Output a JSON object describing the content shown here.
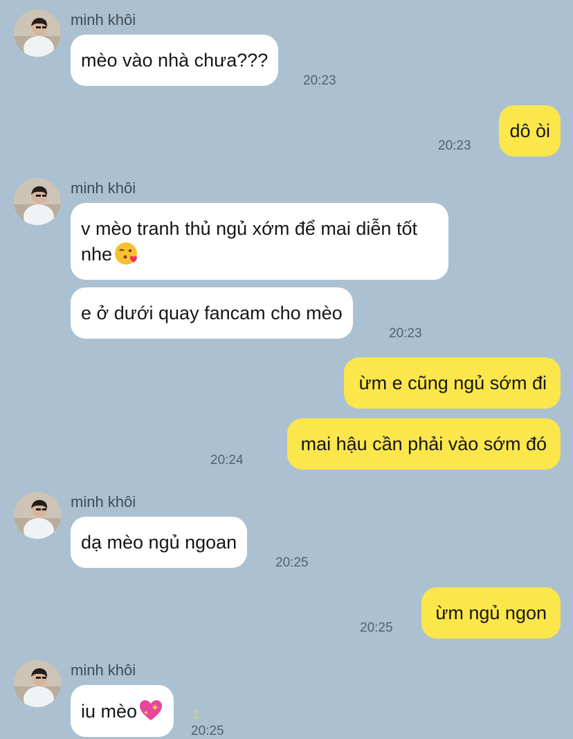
{
  "contact": {
    "name": "minh khôi"
  },
  "messages": [
    {
      "text": "mèo vào nhà chưa???",
      "time": "20:23"
    },
    {
      "text": "dô òi",
      "time": "20:23"
    },
    {
      "text": "v mèo tranh thủ ngủ xớm để mai diễn tốt nhe",
      "emoji": "kissing-heart-emoji"
    },
    {
      "text": "e ở dưới quay fancam cho mèo",
      "time": "20:23"
    },
    {
      "text": "ừm e cũng ngủ sớm đi"
    },
    {
      "text": "mai hậu cần phải vào sớm đó",
      "time": "20:24"
    },
    {
      "text": "dạ mèo ngủ ngoan",
      "time": "20:25"
    },
    {
      "text": "ừm ngủ ngon",
      "time": "20:25"
    },
    {
      "text": "iu mèo",
      "emoji": "sparkling-heart-emoji",
      "time": "20:25",
      "unread": "1"
    }
  ],
  "colors": {
    "background": "#abc1d1",
    "incoming_bubble": "#ffffff",
    "outgoing_bubble": "#fbe64b"
  }
}
